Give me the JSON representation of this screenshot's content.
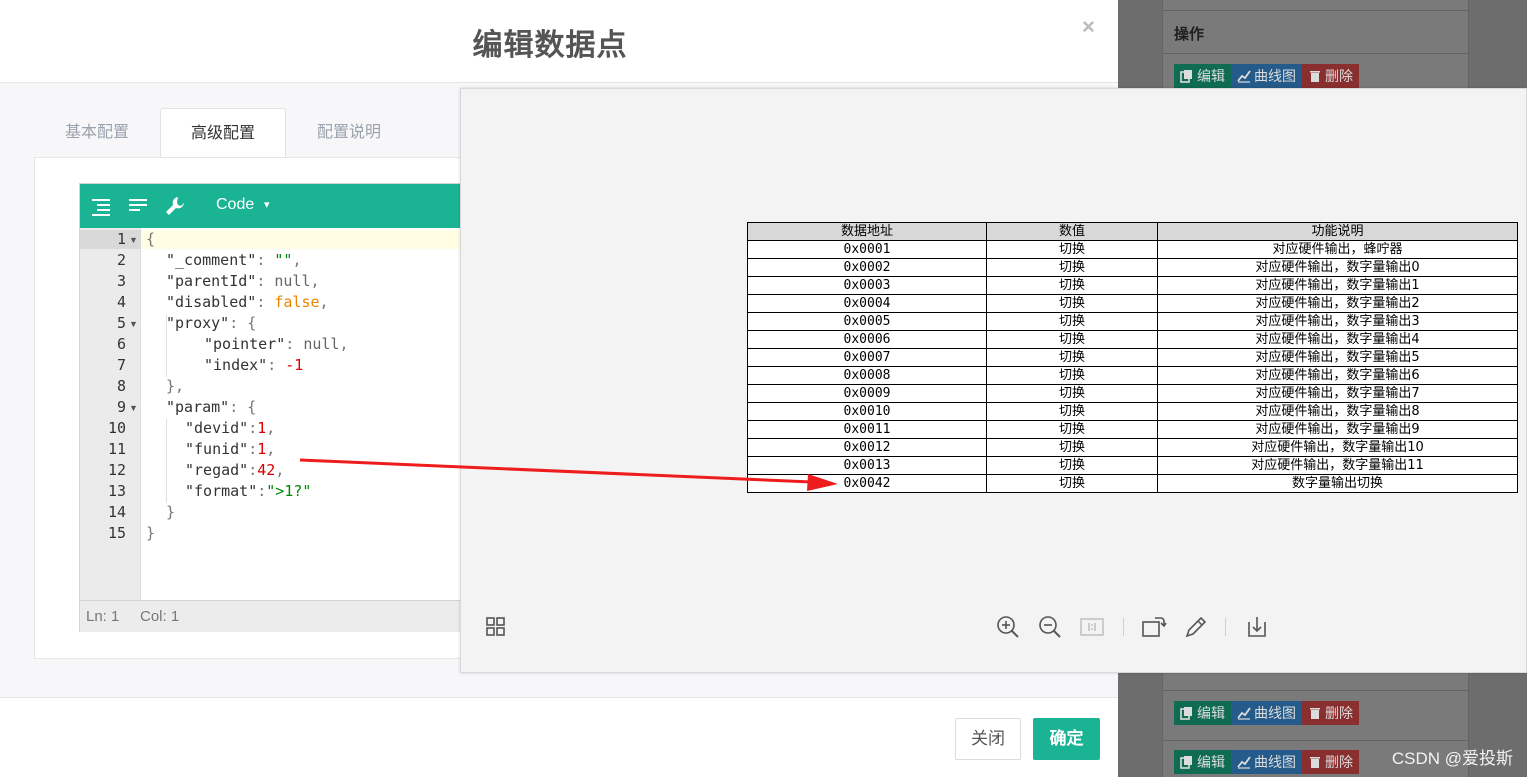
{
  "background": {
    "operations_header": "操作",
    "row_buttons": {
      "edit": "编辑",
      "curve": "曲线图",
      "delete": "删除"
    },
    "watermark": "CSDN @爱投斯"
  },
  "dialog": {
    "title": "编辑数据点",
    "close_glyph": "×",
    "tabs": [
      {
        "label": "基本配置",
        "active": false
      },
      {
        "label": "高级配置",
        "active": true
      },
      {
        "label": "配置说明",
        "active": false
      }
    ],
    "footer": {
      "close_label": "关闭",
      "confirm_label": "确定"
    }
  },
  "editor": {
    "mode_label": "Code",
    "mode_arrow": "▾",
    "status": {
      "line": "Ln: 1",
      "col": "Col: 1"
    },
    "line_numbers": [
      "1",
      "2",
      "3",
      "4",
      "5",
      "6",
      "7",
      "8",
      "9",
      "10",
      "11",
      "12",
      "13",
      "14",
      "15"
    ]
  },
  "viewer": {
    "table": {
      "headers": [
        "数据地址",
        "数值",
        "功能说明"
      ],
      "rows": [
        [
          "0x0001",
          "切换",
          "对应硬件输出，蜂咛器"
        ],
        [
          "0x0002",
          "切换",
          "对应硬件输出，数字量输出0"
        ],
        [
          "0x0003",
          "切换",
          "对应硬件输出，数字量输出1"
        ],
        [
          "0x0004",
          "切换",
          "对应硬件输出，数字量输出2"
        ],
        [
          "0x0005",
          "切换",
          "对应硬件输出，数字量输出3"
        ],
        [
          "0x0006",
          "切换",
          "对应硬件输出，数字量输出4"
        ],
        [
          "0x0007",
          "切换",
          "对应硬件输出，数字量输出5"
        ],
        [
          "0x0008",
          "切换",
          "对应硬件输出，数字量输出6"
        ],
        [
          "0x0009",
          "切换",
          "对应硬件输出，数字量输出7"
        ],
        [
          "0x0010",
          "切换",
          "对应硬件输出，数字量输出8"
        ],
        [
          "0x0011",
          "切换",
          "对应硬件输出，数字量输出9"
        ],
        [
          "0x0012",
          "切换",
          "对应硬件输出，数字量输出10"
        ],
        [
          "0x0013",
          "切换",
          "对应硬件输出，数字量输出11"
        ],
        [
          "0x0042",
          "切换",
          "数字量输出切换"
        ]
      ]
    },
    "toolbar_icons": [
      "grid-icon",
      "zoom-in-icon",
      "zoom-out-icon",
      "actual-size-icon",
      "rotate-icon",
      "pencil-icon",
      "download-icon"
    ]
  },
  "colors": {
    "primary": "#1ab394",
    "arrow": "#ee1c1c"
  }
}
